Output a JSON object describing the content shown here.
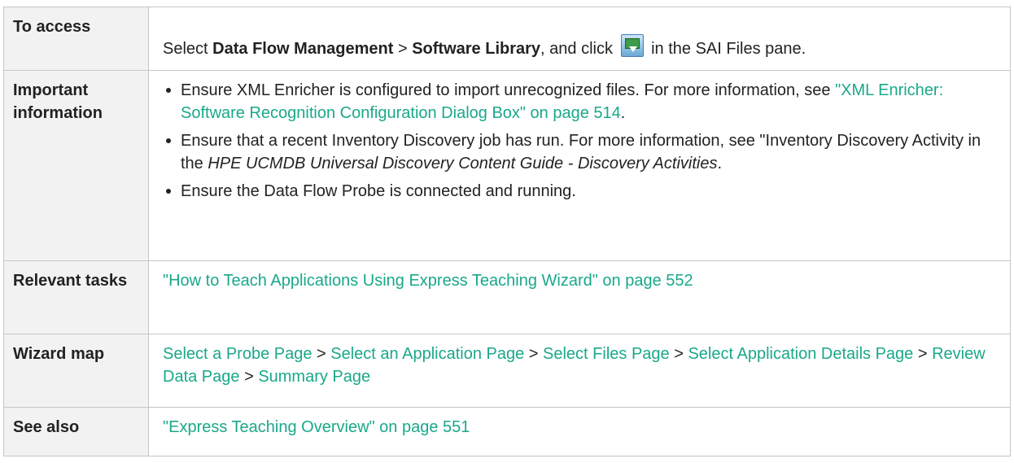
{
  "rows": [
    {
      "label": "To access",
      "parts": {
        "p1": "Select ",
        "b1": "Data Flow Management",
        "p2": " > ",
        "b2": "Software Library",
        "p3": ", and click ",
        "icon": "upload-probe-icon",
        "p4": " in the SAI Files pane."
      }
    },
    {
      "label": "Important information",
      "bullets": [
        {
          "text": "Ensure XML Enricher is configured to import unrecognized files. For more information, see ",
          "link": "\"XML Enricher: Software Recognition Configuration Dialog Box\" on page 514",
          "tail": "."
        },
        {
          "text": "Ensure that a recent Inventory Discovery job has run. For more information, see \"Inventory Discovery Activity in the ",
          "italic": "HPE UCMDB Universal Discovery Content Guide - Discovery Activities",
          "tail": "."
        },
        {
          "text": "Ensure the Data Flow Probe is connected and running."
        }
      ]
    },
    {
      "label": "Relevant tasks",
      "link": "\"How to Teach Applications Using Express Teaching Wizard\" on page 552"
    },
    {
      "label": "Wizard map",
      "steps": [
        "Select a Probe Page",
        "Select an Application Page",
        "Select Files Page",
        "Select Application Details Page",
        "Review Data Page",
        "Summary Page"
      ],
      "separator": " > "
    },
    {
      "label": "See also",
      "link": "\"Express Teaching Overview\" on page 551"
    }
  ],
  "colors": {
    "link": "#1aa88a",
    "label_bg": "#f2f2f2",
    "border": "#c6c6c6"
  }
}
